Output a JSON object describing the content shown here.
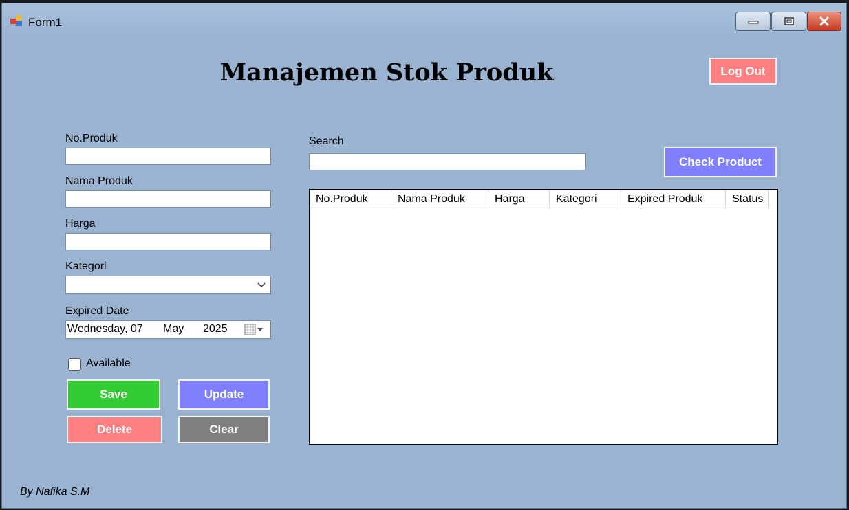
{
  "window": {
    "title": "Form1"
  },
  "header": {
    "title": "Manajemen Stok Produk",
    "logout_label": "Log Out"
  },
  "form": {
    "no_produk_label": "No.Produk",
    "nama_produk_label": "Nama Produk",
    "harga_label": "Harga",
    "kategori_label": "Kategori",
    "expired_label": "Expired Date",
    "expired_value": {
      "weekday": "Wednesday, 07",
      "month": "May",
      "year": "2025"
    },
    "available_label": "Available",
    "no_produk_value": "",
    "nama_produk_value": "",
    "harga_value": "",
    "kategori_value": ""
  },
  "actions": {
    "save": "Save",
    "update": "Update",
    "delete": "Delete",
    "clear": "Clear"
  },
  "search": {
    "label": "Search",
    "value": "",
    "check_label": "Check Product"
  },
  "table": {
    "columns": [
      "No.Produk",
      "Nama Produk",
      "Harga",
      "Kategori",
      "Expired Produk",
      "Status"
    ],
    "rows": []
  },
  "footer": {
    "credit": "By Nafika S.M"
  },
  "colors": {
    "background": "#99b3d1",
    "save": "#33cc33",
    "update": "#8080ff",
    "delete": "#ff8080",
    "clear": "#808080",
    "logout": "#ff8080",
    "check": "#8080ff"
  }
}
